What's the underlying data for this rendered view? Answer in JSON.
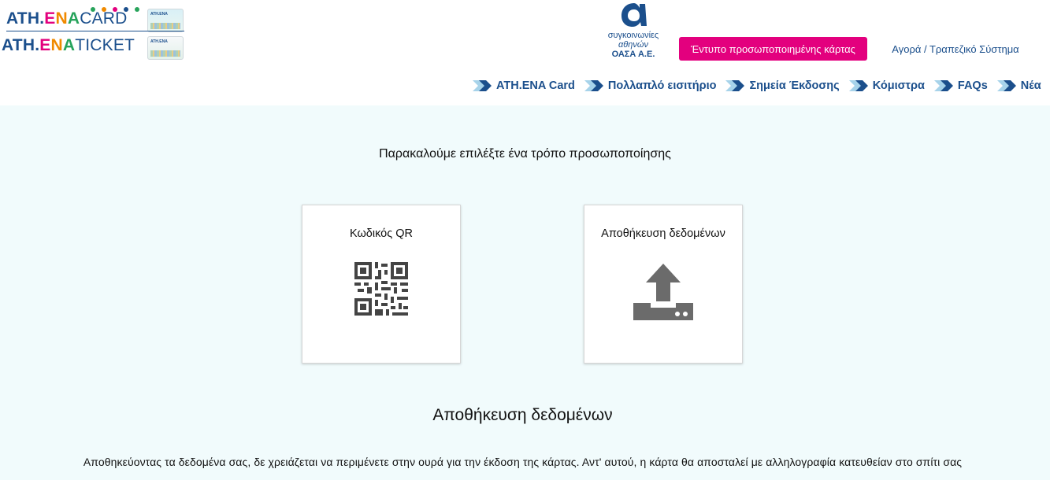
{
  "header": {
    "logo": {
      "card_prefix": "ATH.",
      "card_e": "E",
      "card_n": "N",
      "card_a": "A",
      "card_suffix": "CARD",
      "ticket_prefix": "ATH.",
      "ticket_e": "E",
      "ticket_n": "N",
      "ticket_a": "A",
      "ticket_suffix": "TICKET",
      "thumb_text": "ATH.ENA"
    },
    "oasa": {
      "line1": "συγκοινωνίες",
      "line2": "αθηνών",
      "line3": "ΟΑΣΑ Α.Ε."
    },
    "pink_button": "Έντυπο προσωποποιημένης κάρτας",
    "buy_link": "Αγορά / Τραπεζικό Σύστημα",
    "nav": [
      {
        "label": "ATH.ENA Card"
      },
      {
        "label": "Πολλαπλό εισιτήριο"
      },
      {
        "label": "Σημεία Έκδοσης"
      },
      {
        "label": "Κόμιστρα"
      },
      {
        "label": "FAQs"
      },
      {
        "label": "Νέα"
      }
    ]
  },
  "main": {
    "prompt": "Παρακαλούμε επιλέξτε ένα τρόπο προσωποποίησης",
    "options": [
      {
        "title": "Κωδικός QR",
        "icon": "qr-code-icon"
      },
      {
        "title": "Αποθήκευση δεδομένων",
        "icon": "upload-icon"
      }
    ],
    "section_title": "Αποθήκευση δεδομένων",
    "section_text": "Αποθηκεύοντας τα δεδομένα σας, δε χρειάζεται να περιμένετε στην ουρά για την έκδοση της κάρτας. Αντ' αυτού, η κάρτα θα αποσταλεί με αλληλογραφία κατευθείαν στο σπίτι σας"
  },
  "colors": {
    "brand_blue": "#1b4f8c",
    "pink": "#e3007e",
    "bg_main": "#f1fbfc",
    "icon_gray": "#666666"
  }
}
